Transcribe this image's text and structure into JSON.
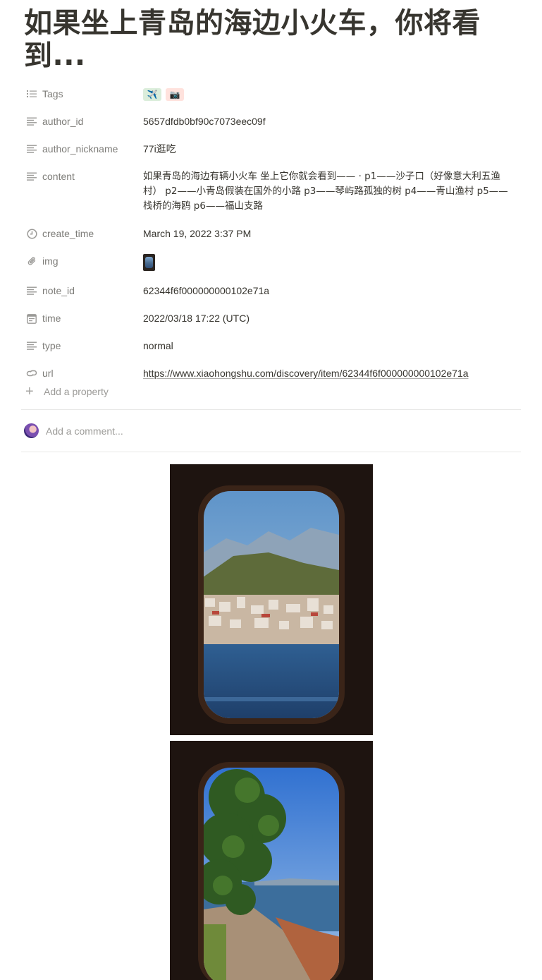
{
  "page": {
    "title": "如果坐上青岛的海边小火车，你将看到..."
  },
  "properties": [
    {
      "key": "tags",
      "label": "Tags",
      "icon": "list-icon"
    },
    {
      "key": "author_id",
      "label": "author_id",
      "icon": "text-icon",
      "value": "5657dfdb0bf90c7073eec09f"
    },
    {
      "key": "author_nickname",
      "label": "author_nickname",
      "icon": "text-icon",
      "value": "77i逛吃"
    },
    {
      "key": "content",
      "label": "content",
      "icon": "text-icon",
      "value": "如果青岛的海边有辆小火车 坐上它你就会看到—— · p1——沙子口（好像意大利五渔村） p2——小青岛假装在国外的小路 p3——琴屿路孤独的树 p4——青山渔村 p5——栈桥的海鸥 p6——福山支路"
    },
    {
      "key": "create_time",
      "label": "create_time",
      "icon": "clock-icon",
      "value": "March 19, 2022 3:37 PM"
    },
    {
      "key": "img",
      "label": "img",
      "icon": "paperclip-icon"
    },
    {
      "key": "note_id",
      "label": "note_id",
      "icon": "text-icon",
      "value": "62344f6f000000000102e71a"
    },
    {
      "key": "time",
      "label": "time",
      "icon": "calendar-icon",
      "value": "2022/03/18 17:22 (UTC)"
    },
    {
      "key": "type",
      "label": "type",
      "icon": "text-icon",
      "value": "normal"
    },
    {
      "key": "url",
      "label": "url",
      "icon": "link-icon",
      "value": "https://www.xiaohongshu.com/discovery/item/62344f6f000000000102e71a"
    }
  ],
  "tags": [
    {
      "emoji": "✈️",
      "color": "#dbeddb"
    },
    {
      "emoji": "📷",
      "color": "#ffe2dd"
    }
  ],
  "add_property_label": "Add a property",
  "comment": {
    "placeholder": "Add a comment..."
  }
}
